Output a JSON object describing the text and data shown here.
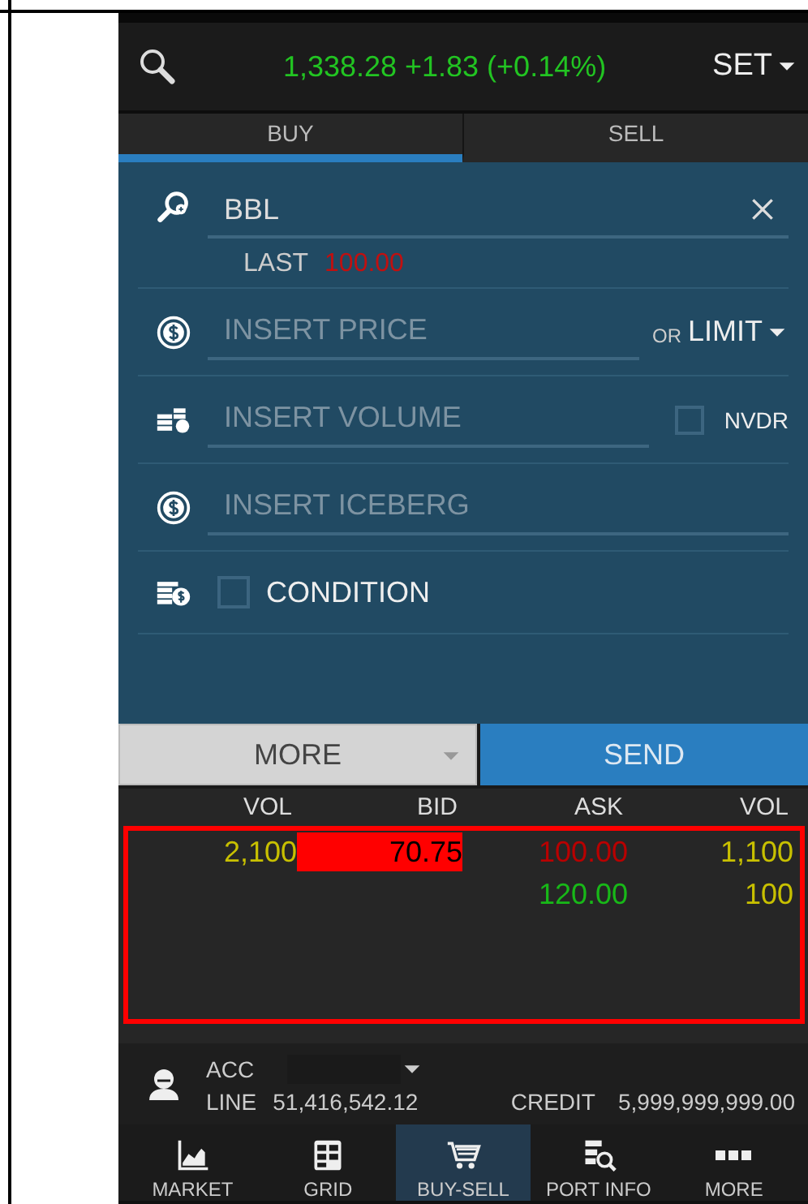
{
  "header": {
    "index_text": "1,338.28 +1.83 (+0.14%)",
    "market": "SET"
  },
  "tabs": [
    {
      "label": "BUY",
      "selected": true
    },
    {
      "label": "SELL",
      "selected": false
    }
  ],
  "form": {
    "symbol": {
      "value": "BBL"
    },
    "last": {
      "label": "LAST",
      "value": "100.00"
    },
    "price": {
      "placeholder": "INSERT PRICE",
      "or": "OR",
      "type": "LIMIT"
    },
    "volume": {
      "placeholder": "INSERT VOLUME",
      "nvdr": {
        "label": "NVDR",
        "checked": false
      }
    },
    "iceberg": {
      "placeholder": "INSERT ICEBERG"
    },
    "condition": {
      "label": "CONDITION",
      "checked": false
    }
  },
  "buttons": {
    "more": "MORE",
    "send": "SEND"
  },
  "order_book": {
    "outlined": true,
    "columns": [
      "VOL",
      "BID",
      "ASK",
      "VOL"
    ],
    "rows": [
      {
        "bid_volume": "2,100",
        "bid": "70.75",
        "bid_flash": true,
        "ask": {
          "text": "100.00",
          "color": "#b80000"
        },
        "ask_volume": "1,100"
      },
      {
        "ask": {
          "text": "120.00",
          "color": "#18b818"
        },
        "ask_volume": "100"
      }
    ]
  },
  "account": {
    "acc_label": "ACC",
    "line_label": "LINE",
    "line_value": "51,416,542.12",
    "credit_label": "CREDIT",
    "credit_value": "5,999,999,999.00"
  },
  "nav": [
    {
      "label": "MARKET",
      "selected": false
    },
    {
      "label": "GRID",
      "selected": false
    },
    {
      "label": "BUY-SELL",
      "selected": true
    },
    {
      "label": "PORT INFO",
      "selected": false
    },
    {
      "label": "MORE",
      "selected": false
    }
  ]
}
